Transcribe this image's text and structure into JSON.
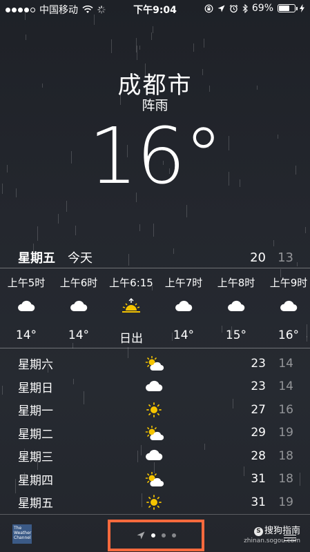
{
  "status_bar": {
    "carrier": "中国移动",
    "time": "下午9:04",
    "battery_percent": "69%",
    "battery_level": 0.69
  },
  "location": {
    "city": "成都市",
    "condition": "阵雨",
    "temperature": "16°"
  },
  "today": {
    "day": "星期五",
    "label": "今天",
    "high": "20",
    "low": "13"
  },
  "hourly": [
    {
      "time": "上午5时",
      "icon": "cloud-icon",
      "value": "14°"
    },
    {
      "time": "上午6时",
      "icon": "cloud-icon",
      "value": "14°"
    },
    {
      "time": "上午6:15",
      "icon": "sunrise-icon",
      "value": "日出"
    },
    {
      "time": "上午7时",
      "icon": "cloud-icon",
      "value": "14°"
    },
    {
      "time": "上午8时",
      "icon": "cloud-icon",
      "value": "15°"
    },
    {
      "time": "上午9时",
      "icon": "cloud-icon",
      "value": "16°"
    }
  ],
  "daily": [
    {
      "day": "星期六",
      "icon": "partly-cloudy-icon",
      "high": "23",
      "low": "14"
    },
    {
      "day": "星期日",
      "icon": "cloud-icon",
      "high": "23",
      "low": "14"
    },
    {
      "day": "星期一",
      "icon": "sun-icon",
      "high": "27",
      "low": "16"
    },
    {
      "day": "星期二",
      "icon": "partly-cloudy-icon",
      "high": "29",
      "low": "19"
    },
    {
      "day": "星期三",
      "icon": "cloud-icon",
      "high": "28",
      "low": "18"
    },
    {
      "day": "星期四",
      "icon": "partly-cloudy-icon",
      "high": "31",
      "low": "18"
    },
    {
      "day": "星期五",
      "icon": "sun-icon",
      "high": "31",
      "low": "19"
    }
  ],
  "footer": {
    "logo_text": "The Weather Channel",
    "page_count": 3,
    "active_page": 1,
    "watermark_name": "搜狗指南",
    "watermark_url": "zhinan.sogou.com"
  },
  "colors": {
    "highlight_box": "#ff6a3d",
    "sun": "#f5c400"
  }
}
